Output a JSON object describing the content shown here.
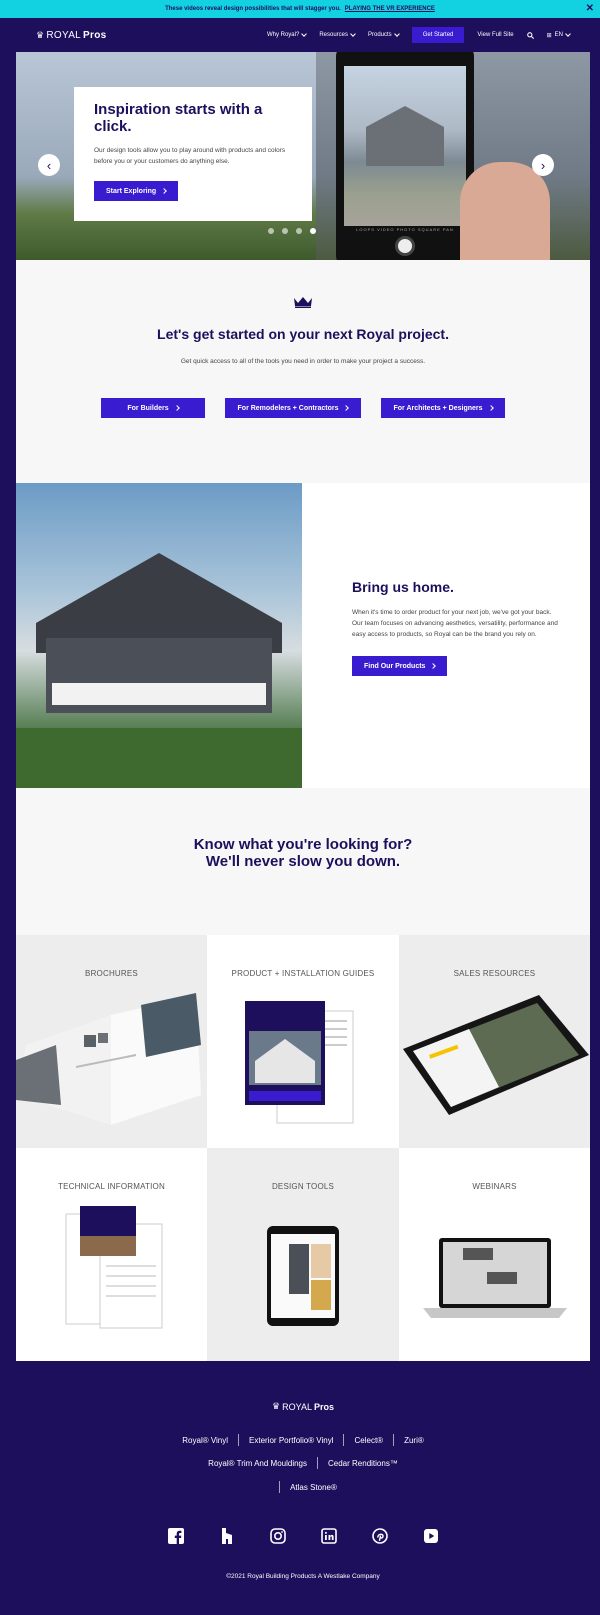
{
  "promo": {
    "text": "These videos reveal design possibilities that will stagger you.",
    "link": "PLAYING THE VR EXPERIENCE"
  },
  "nav": {
    "logo_light": "ROYAL",
    "logo_bold": "Pros",
    "items": [
      "Why Royal?",
      "Resources",
      "Products"
    ],
    "cta": "Get Started",
    "full_site": "View Full Site",
    "language": "EN"
  },
  "hero": {
    "title": "Inspiration starts with a click.",
    "body": "Our design tools allow you to play around with products and colors before you or your customers do anything else.",
    "button": "Start Exploring",
    "phone_modes": "LOOPS  VIDEO  PHOTO  SQUARE  PAN"
  },
  "started": {
    "title": "Let's get started on your next Royal project.",
    "body": "Get quick access to all of the tools you need in order to make your project a success.",
    "buttons": [
      "For Builders",
      "For Remodelers + Contractors",
      "For Architects + Designers"
    ]
  },
  "home": {
    "title": "Bring us home.",
    "body": "When it's time to order product for your next job, we've got your back. Our team focuses on advancing aesthetics, versatility, performance and easy access to products, so Royal can be the brand you rely on.",
    "button": "Find Our Products"
  },
  "know": {
    "title": "Know what you're looking for? We'll never slow you down."
  },
  "tiles": [
    {
      "label": "BROCHURES"
    },
    {
      "label": "PRODUCT + INSTALLATION GUIDES"
    },
    {
      "label": "SALES RESOURCES"
    },
    {
      "label": "TECHNICAL INFORMATION"
    },
    {
      "label": "DESIGN TOOLS"
    },
    {
      "label": "WEBINARS"
    }
  ],
  "footer": {
    "logo_light": "ROYAL",
    "logo_bold": "Pros",
    "row1": [
      "Royal® Vinyl",
      "Exterior Portfolio® Vinyl",
      "Celect®",
      "Zuri®"
    ],
    "row2": [
      "Royal® Trim And Mouldings",
      "Cedar Renditions™"
    ],
    "row3": [
      "Atlas Stone®"
    ],
    "copyright": "©2021 Royal Building Products A Westlake Company"
  },
  "colors": {
    "brand_navy": "#1e0f5c",
    "brand_purple": "#3a1cd0",
    "promo_cyan": "#12d1e1"
  }
}
